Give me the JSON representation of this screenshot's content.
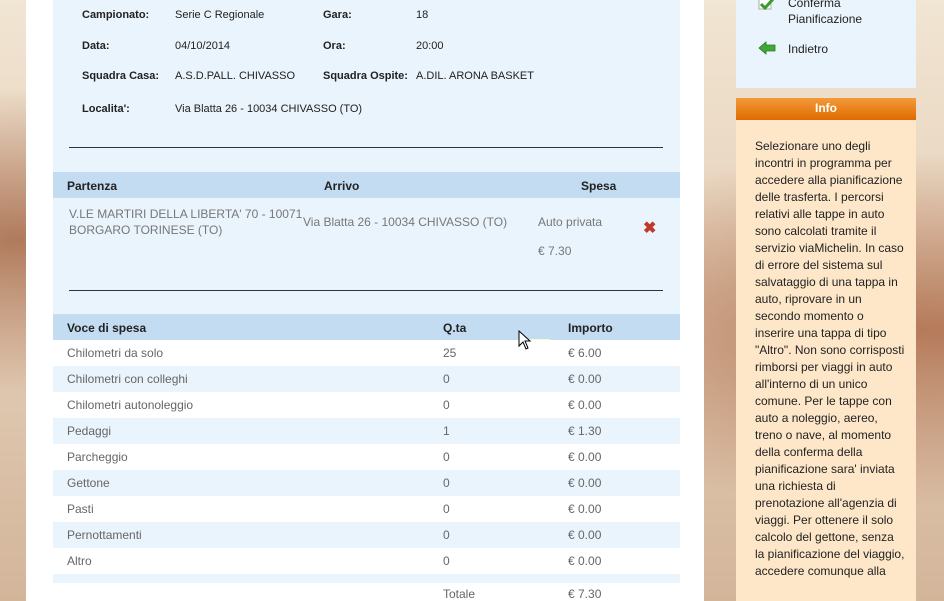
{
  "match": {
    "campionato_label": "Campionato:",
    "campionato_value": "Serie C Regionale",
    "gara_label": "Gara:",
    "gara_value": "18",
    "data_label": "Data:",
    "data_value": "04/10/2014",
    "ora_label": "Ora:",
    "ora_value": "20:00",
    "casa_label": "Squadra Casa:",
    "casa_value": "A.S.D.PALL. CHIVASSO",
    "ospite_label": "Squadra Ospite:",
    "ospite_value": "A.DIL. ARONA BASKET",
    "localita_label": "Localita':",
    "localita_value": "Via Blatta 26 - 10034 CHIVASSO (TO)"
  },
  "trip_table": {
    "headers": [
      "Partenza",
      "Arrivo",
      "Spesa"
    ],
    "row": {
      "partenza_line1": "V.LE MARTIRI DELLA LIBERTA' 70 - 10071",
      "partenza_line2": "BORGARO TORINESE (TO)",
      "arrivo": "Via Blatta 26 - 10034 CHIVASSO (TO)",
      "mezzo": "Auto privata",
      "spesa": "€ 7.30",
      "delete_icon": "red-x-icon"
    }
  },
  "cost_table": {
    "headers": [
      "Voce di spesa",
      "Q.ta",
      "Importo"
    ],
    "rows": [
      {
        "voce": "Chilometri da solo",
        "qta": "25",
        "importo": "€ 6.00"
      },
      {
        "voce": "Chilometri con colleghi",
        "qta": "0",
        "importo": "€ 0.00"
      },
      {
        "voce": "Chilometri autonoleggio",
        "qta": "0",
        "importo": "€ 0.00"
      },
      {
        "voce": "Pedaggi",
        "qta": "1",
        "importo": "€ 1.30"
      },
      {
        "voce": "Parcheggio",
        "qta": "0",
        "importo": "€ 0.00"
      },
      {
        "voce": "Gettone",
        "qta": "0",
        "importo": "€ 0.00"
      },
      {
        "voce": "Pasti",
        "qta": "0",
        "importo": "€ 0.00"
      },
      {
        "voce": "Pernottamenti",
        "qta": "0",
        "importo": "€ 0.00"
      },
      {
        "voce": "Altro",
        "qta": "0",
        "importo": "€ 0.00"
      }
    ],
    "total_label": "Totale",
    "total_value": "€ 7.30"
  },
  "actions": {
    "confirm_line1": "Conferma",
    "confirm_line2": "Pianificazione",
    "confirm_icon": "green-check-icon",
    "back_label": "Indietro",
    "back_icon": "green-arrow-left-icon"
  },
  "info": {
    "title": "Info",
    "text": "Selezionare uno degli incontri in programma per accedere alla pianificazione delle trasferta. I percorsi relativi alle tappe in auto sono calcolati tramite il servizio viaMichelin. In caso di errore del sistema sul salvataggio di una tappa in auto, riprovare in un secondo momento o inserire una tappa di tipo \"Altro\". Non sono corrisposti rimborsi per viaggi in auto all'interno di un unico comune. Per le tappe con auto a noleggio, aereo, treno o nave, al momento della conferma della pianificazione sara' inviata una richiesta di prenotazione all'agenzia di viaggi. Per ottenere il solo calcolo del gettone, senza la pianificazione del viaggio, accedere comunque alla"
  },
  "colors": {
    "panel_bg": "#eaf4fc",
    "header_bg": "#c3dcf2",
    "info_bg": "#fde7c8",
    "info_header": "#e87a10",
    "delete": "#c0392b"
  }
}
